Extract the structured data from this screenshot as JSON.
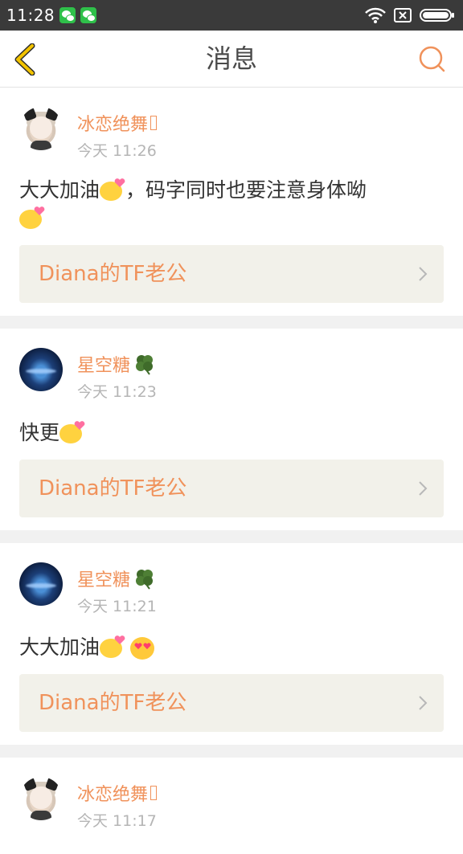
{
  "status_bar": {
    "time": "11:28",
    "icons": [
      "wechat-notification-icon",
      "wechat-notification-icon",
      "wifi-icon",
      "sim-icon",
      "battery-icon"
    ]
  },
  "header": {
    "title": "消息",
    "back_icon": "chevron-left-icon",
    "search_icon": "search-icon"
  },
  "colors": {
    "accent": "#f0925b",
    "back_icon": "#f2c300",
    "link_box_bg": "#f2f1ea",
    "separator": "#f1f1f1",
    "statusbar_bg": "#3a3a3a"
  },
  "messages": [
    {
      "username": "冰恋绝舞",
      "avatar": "anime-avatar",
      "badge_icon": "missing-glyph-icon",
      "time": "今天 11:26",
      "text_line1": "大大加油",
      "text_mid": "，码字同时也要注意身体呦",
      "emojis": [
        "kiss-emoji",
        "kiss-emoji"
      ],
      "link": "Diana的TF老公"
    },
    {
      "username": "星空糖",
      "avatar": "starry-sky-avatar",
      "badge_icon": "clover-icon",
      "time": "今天 11:23",
      "text": "快更",
      "emojis": [
        "kiss-emoji"
      ],
      "link": "Diana的TF老公"
    },
    {
      "username": "星空糖",
      "avatar": "starry-sky-avatar",
      "badge_icon": "clover-icon",
      "time": "今天 11:21",
      "text": "大大加油",
      "emojis": [
        "kiss-emoji",
        "heart-eyes-emoji"
      ],
      "link": "Diana的TF老公"
    },
    {
      "username": "冰恋绝舞",
      "avatar": "anime-avatar",
      "badge_icon": "missing-glyph-icon",
      "time": "今天 11:17"
    }
  ]
}
